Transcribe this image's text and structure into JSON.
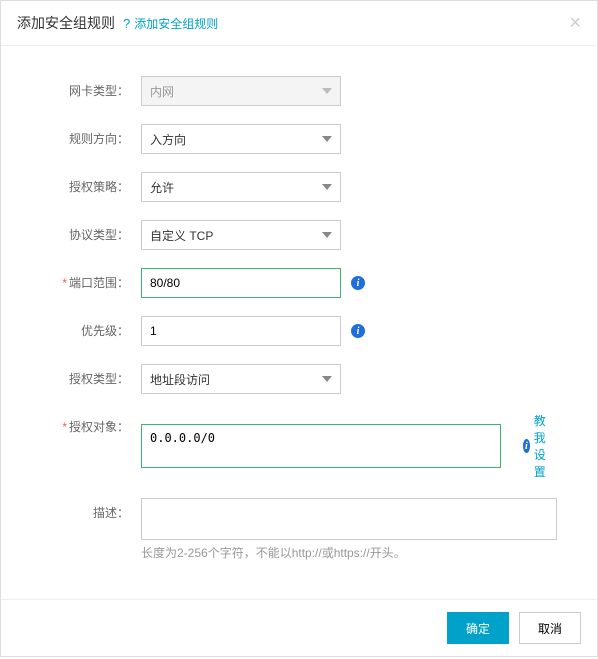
{
  "header": {
    "title": "添加安全组规则",
    "help_icon": "?",
    "sub_title": "添加安全组规则",
    "close": "×"
  },
  "form": {
    "nic_type": {
      "label": "网卡类型：",
      "value": "内网"
    },
    "direction": {
      "label": "规则方向：",
      "value": "入方向"
    },
    "policy": {
      "label": "授权策略：",
      "value": "允许"
    },
    "protocol": {
      "label": "协议类型：",
      "value": "自定义 TCP"
    },
    "port_range": {
      "label": "端口范围：",
      "value": "80/80",
      "required_mark": "*"
    },
    "priority": {
      "label": "优先级：",
      "value": "1"
    },
    "auth_type": {
      "label": "授权类型：",
      "value": "地址段访问"
    },
    "auth_object": {
      "label": "授权对象：",
      "value": "0.0.0.0/0",
      "required_mark": "*",
      "help_link": "教我设置"
    },
    "description": {
      "label": "描述：",
      "value": "",
      "hint": "长度为2-256个字符，不能以http://或https://开头。"
    }
  },
  "footer": {
    "confirm": "确定",
    "cancel": "取消"
  },
  "info_glyph": "i"
}
